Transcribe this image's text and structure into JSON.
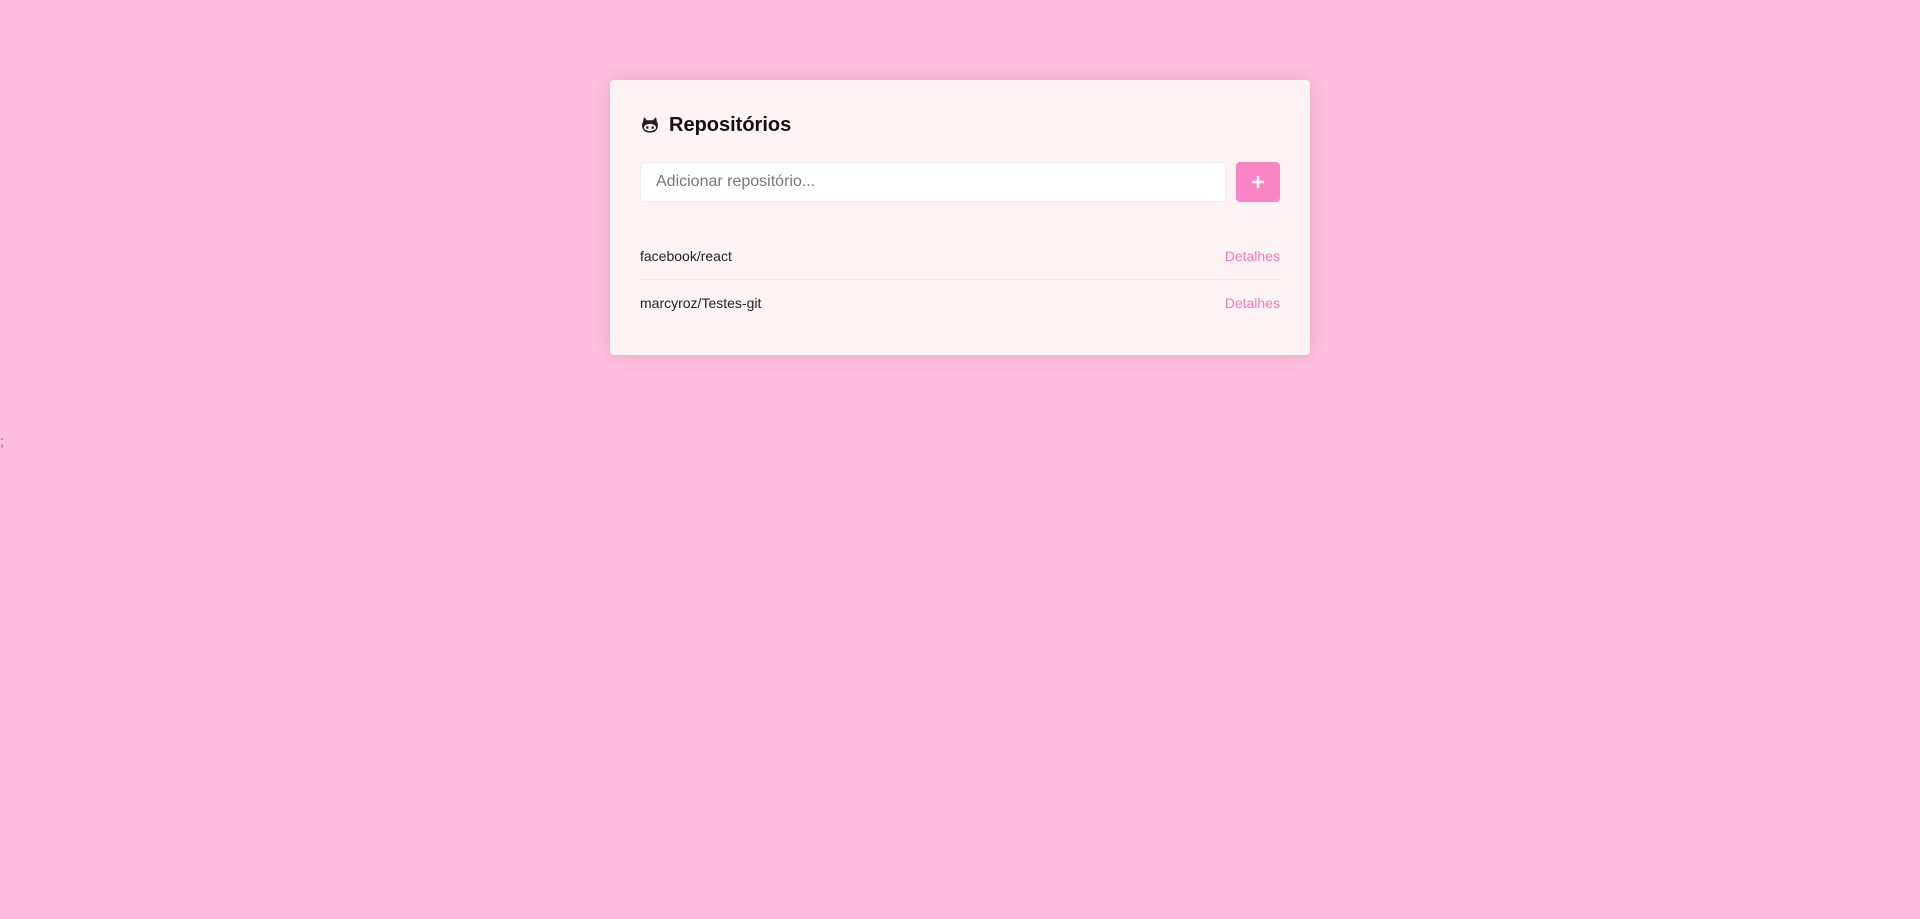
{
  "page": {
    "stray_text": ";"
  },
  "header": {
    "title": "Repositórios",
    "icon": "github-icon"
  },
  "form": {
    "placeholder": "Adicionar repositório...",
    "value": "",
    "submit_icon": "plus-icon"
  },
  "repositories": [
    {
      "name": "facebook/react",
      "link_label": "Detalhes"
    },
    {
      "name": "marcyroz/Testes-git",
      "link_label": "Detalhes"
    }
  ],
  "colors": {
    "background": "#fdbfdd",
    "card": "#fef3f4",
    "accent": "#fb84c5",
    "link": "#f57bbf"
  }
}
